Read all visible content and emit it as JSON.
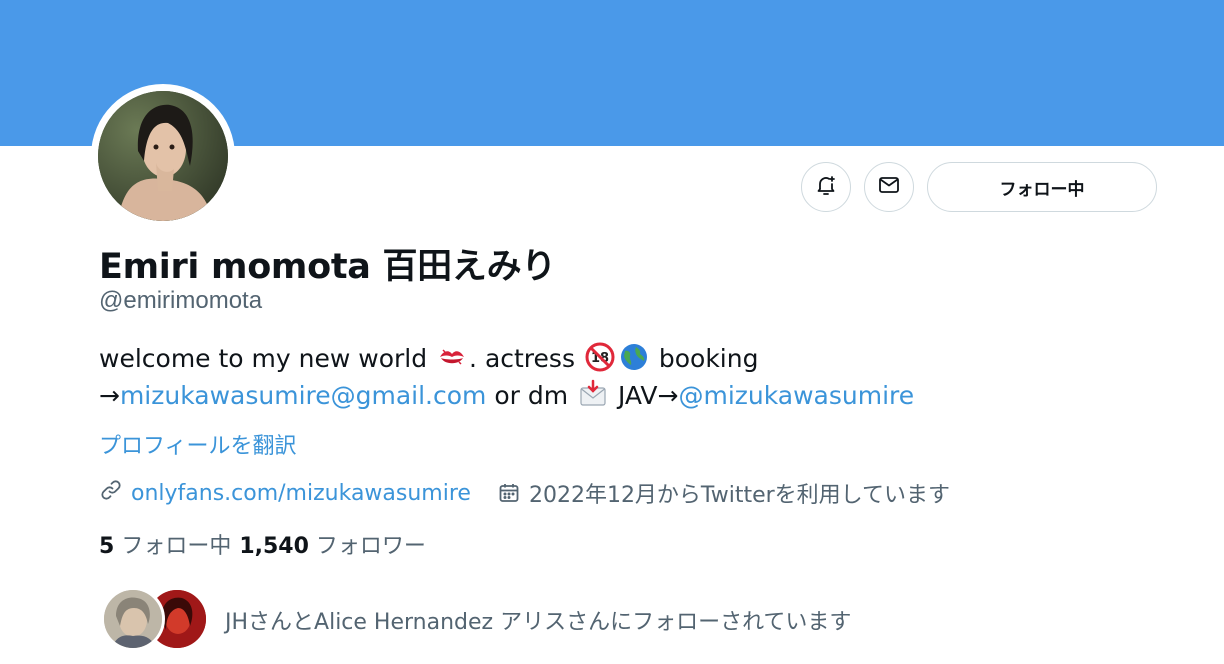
{
  "profile": {
    "display_name": "Emiri momota 百田えみり",
    "handle": "@emirimomota",
    "avatar_icon": "profile-photo"
  },
  "actions": {
    "bell_icon": "notification-bell-icon",
    "mail_icon": "mail-icon",
    "follow_label": "フォロー中"
  },
  "bio": {
    "line1_a": "welcome to my new world ",
    "line1_b": ". actress ",
    "line1_c": " booking",
    "line2_arrow": "→",
    "line2_email": "mizukawasumire@gmail.com",
    "line2_mid": " or dm ",
    "line2_jav": " JAV→",
    "line2_mention": "@mizukawasumire",
    "emojis": [
      "kiss-mark-emoji",
      "no-one-under-eighteen-emoji",
      "globe-emoji",
      "incoming-envelope-emoji"
    ]
  },
  "translate_label": "プロフィールを翻訳",
  "meta": {
    "url": "onlyfans.com/mizukawasumire",
    "joined": "2022年12月からTwitterを利用しています",
    "link_icon": "link-icon",
    "calendar_icon": "calendar-icon"
  },
  "stats": {
    "following_count": "5",
    "following_label": "フォロー中",
    "followers_count": "1,540",
    "followers_label": "フォロワー"
  },
  "mutual": {
    "text": "JHさんとAlice Hernandez アリスさんにフォローされています"
  },
  "colors": {
    "banner": "#4a99e9",
    "link": "#3b94d9",
    "secondary_text": "#536471"
  }
}
